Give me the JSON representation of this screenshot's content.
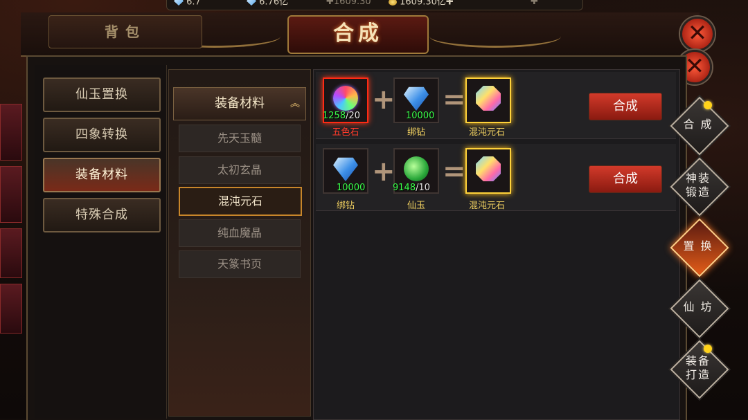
{
  "currency": {
    "diamond_amount": "6.7",
    "bound_diamond_amount": "6.76亿",
    "third_amount": "1609.30",
    "gold_amount": "1609.30亿"
  },
  "header": {
    "bag_tab": "背包",
    "title": "合成",
    "close_icon": "✕"
  },
  "left_menu": [
    {
      "label": "仙玉置换",
      "active": false
    },
    {
      "label": "四象转换",
      "active": false
    },
    {
      "label": "装备材料",
      "active": true
    },
    {
      "label": "特殊合成",
      "active": false
    }
  ],
  "category": {
    "header": "装备材料",
    "chevron": "︽",
    "items": [
      {
        "label": "先天玉髓",
        "active": false
      },
      {
        "label": "太初玄晶",
        "active": false
      },
      {
        "label": "混沌元石",
        "active": true
      },
      {
        "label": "纯血魔晶",
        "active": false
      },
      {
        "label": "天篆书页",
        "active": false
      }
    ]
  },
  "recipes": [
    {
      "inputs": [
        {
          "name": "五色石",
          "have": "1258",
          "need": "/20",
          "icon": "rainbow-orb-icon",
          "name_color": "#ff3a2a"
        },
        {
          "name": "绑钻",
          "have": "10000",
          "need": "",
          "icon": "diamond-icon",
          "name_color": "#f0d060"
        }
      ],
      "output": {
        "name": "混沌元石",
        "icon": "chaos-stone-icon"
      },
      "button": "合成"
    },
    {
      "inputs": [
        {
          "name": "绑钻",
          "have": "10000",
          "need": "",
          "icon": "diamond-icon",
          "name_color": "#f0d060"
        },
        {
          "name": "仙玉",
          "have": "9148",
          "need": "/10",
          "icon": "jade-icon",
          "name_color": "#f0d060"
        }
      ],
      "output": {
        "name": "混沌元石",
        "icon": "chaos-stone-icon"
      },
      "button": "合成"
    }
  ],
  "operators": {
    "plus": "+",
    "equals": "="
  },
  "right_nav": [
    {
      "label": "合 成",
      "dot": true,
      "active": false
    },
    {
      "label": "神装\n锻造",
      "dot": false,
      "active": false
    },
    {
      "label": "置 换",
      "dot": false,
      "active": true
    },
    {
      "label": "仙 坊",
      "dot": false,
      "active": false
    },
    {
      "label": "装备\n打造",
      "dot": true,
      "active": false
    }
  ],
  "colors": {
    "accent_red": "#d23a2a",
    "highlight_gold": "#ffd23a",
    "qty_green": "#3aff4a"
  }
}
